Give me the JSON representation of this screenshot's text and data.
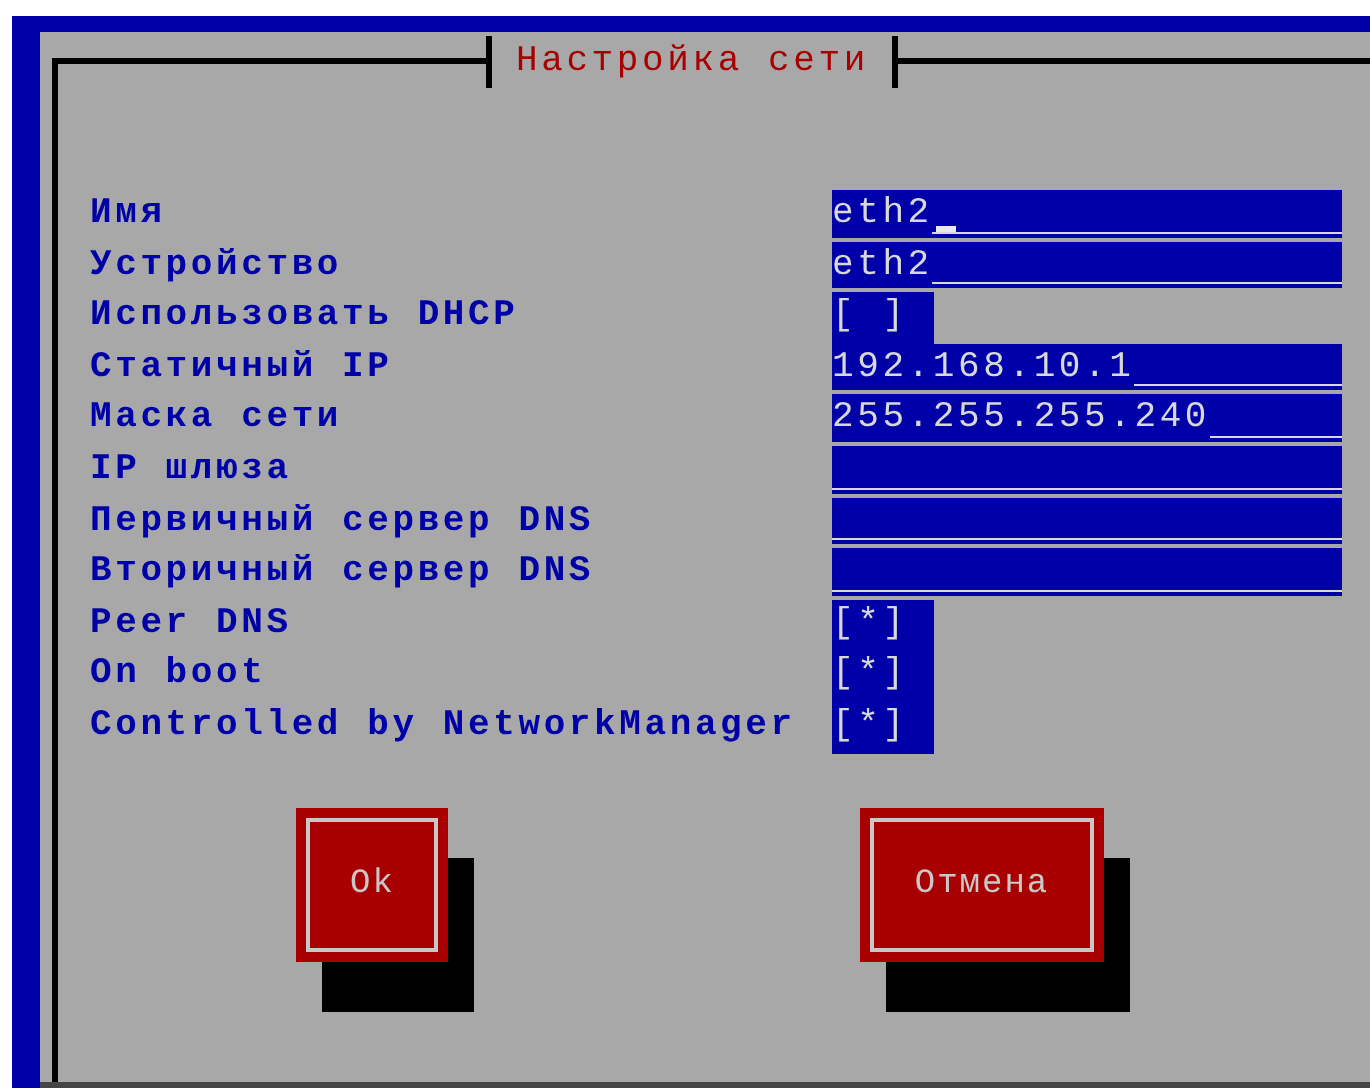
{
  "dialog": {
    "title": "Настройка сети"
  },
  "checkbox_glyphs": {
    "open": "[",
    "close": "]",
    "mark": "*"
  },
  "fields": [
    {
      "kind": "entry",
      "label": "Имя",
      "value": "eth2",
      "focused": true
    },
    {
      "kind": "entry",
      "label": "Устройство",
      "value": "eth2",
      "focused": false
    },
    {
      "kind": "checkbox",
      "label": "Использовать DHCP",
      "checked": false
    },
    {
      "kind": "entry",
      "label": "Статичный IP",
      "value": "192.168.10.1",
      "focused": false
    },
    {
      "kind": "entry",
      "label": "Маска сети",
      "value": "255.255.255.240",
      "focused": false
    },
    {
      "kind": "entry",
      "label": "IP шлюза",
      "focused": false
    },
    {
      "kind": "entry",
      "label": "Первичный сервер DNS",
      "focused": false
    },
    {
      "kind": "entry",
      "label": "Вторичный сервер DNS",
      "focused": false
    },
    {
      "kind": "checkbox",
      "label": "Peer DNS",
      "checked": true
    },
    {
      "kind": "checkbox",
      "label": "On boot",
      "checked": true
    },
    {
      "kind": "checkbox",
      "label": "Controlled by NetworkManager",
      "checked": true
    }
  ],
  "buttons": [
    "Ok",
    "Отмена"
  ]
}
